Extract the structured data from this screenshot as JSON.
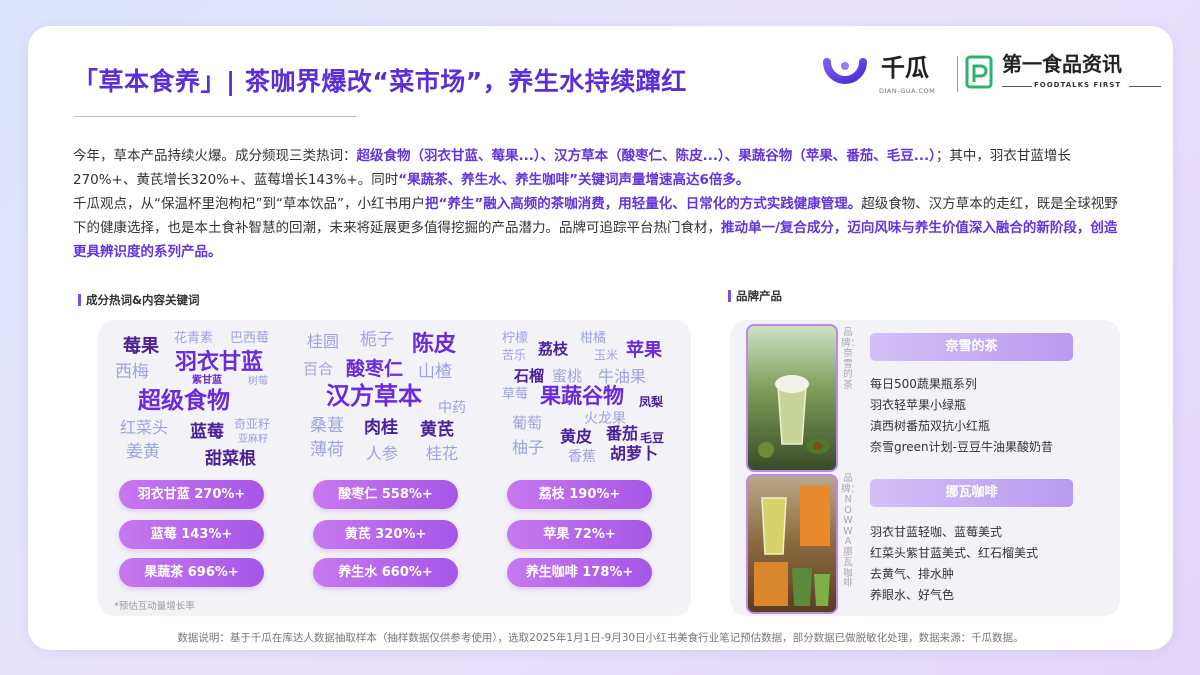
{
  "header": {
    "title": "「草本食养」| 茶咖界爆改“菜市场”，养生水持续蹿红",
    "logo1_name": "千瓜",
    "logo1_sub": "DIAN-GUA.COM",
    "logo2_name": "第一食品资讯",
    "logo2_sub": "FOODTALKS FIRST"
  },
  "intro": {
    "p1": [
      {
        "t": "今年，草本产品持续火爆。成分频现三类热词：",
        "hl": false
      },
      {
        "t": "超级食物（羽衣甘蓝、莓果...）、汉方草本（酸枣仁、陈皮...）、果蔬谷物（苹果、番茄、毛豆...）",
        "hl": true
      },
      {
        "t": "；其中，羽衣甘蓝增长270%+、黄芪增长320%+、蓝莓增长143%+。同时",
        "hl": false
      },
      {
        "t": "“果蔬茶、养生水、养生咖啡”关键词声量增速高达6倍多。",
        "hl": true
      }
    ],
    "p2": [
      {
        "t": "千瓜观点，从“保温杯里泡枸杞”到“草本饮品”，小红书用户",
        "hl": false
      },
      {
        "t": "把“养生”融入高频的茶咖消费，用轻量化、日常化的方式实践健康管理。",
        "hl": true
      },
      {
        "t": "超级食物、汉方草本的走红，既是全球视野下的健康选择，也是本土食补智慧的回潮，未来将延展更多值得挖掘的产品潜力。品牌可追踪平台热门食材，",
        "hl": false
      },
      {
        "t": "推动单一/复合成分，迈向风味与养生价值深入融合的新阶段，创造更具辨识度的系列产品。",
        "hl": true
      }
    ]
  },
  "sections": {
    "keywords_label": "成分热词&内容关键词",
    "brands_label": "品牌产品"
  },
  "wordclouds": [
    {
      "words": [
        {
          "t": "莓果",
          "s": 18,
          "c": "c3"
        },
        {
          "t": "花青素",
          "s": 13,
          "c": "c2"
        },
        {
          "t": "巴西莓",
          "s": 13,
          "c": "c2"
        },
        {
          "t": "西梅",
          "s": 17,
          "c": "c2"
        },
        {
          "t": "羽衣甘蓝",
          "s": 22,
          "c": "c1"
        },
        {
          "t": "紫甘蓝",
          "s": 10,
          "c": "c1"
        },
        {
          "t": "树莓",
          "s": 10,
          "c": "c2"
        },
        {
          "t": "超级食物",
          "s": 23,
          "c": "c1"
        },
        {
          "t": "红菜头",
          "s": 16,
          "c": "c2"
        },
        {
          "t": "蓝莓",
          "s": 17,
          "c": "c3"
        },
        {
          "t": "奇亚籽",
          "s": 12,
          "c": "c2"
        },
        {
          "t": "亚麻籽",
          "s": 10,
          "c": "c2"
        },
        {
          "t": "姜黄",
          "s": 17,
          "c": "c2"
        },
        {
          "t": "甜菜根",
          "s": 17,
          "c": "c3"
        }
      ]
    },
    {
      "words": [
        {
          "t": "桂圆",
          "s": 16,
          "c": "c2"
        },
        {
          "t": "栀子",
          "s": 17,
          "c": "c2"
        },
        {
          "t": "陈皮",
          "s": 22,
          "c": "c1"
        },
        {
          "t": "百合",
          "s": 15,
          "c": "c2"
        },
        {
          "t": "酸枣仁",
          "s": 19,
          "c": "c1"
        },
        {
          "t": "山楂",
          "s": 17,
          "c": "c2"
        },
        {
          "t": "汉方草本",
          "s": 24,
          "c": "c1"
        },
        {
          "t": "中药",
          "s": 14,
          "c": "c2"
        },
        {
          "t": "桑葚",
          "s": 17,
          "c": "c2"
        },
        {
          "t": "肉桂",
          "s": 17,
          "c": "c3"
        },
        {
          "t": "黄芪",
          "s": 17,
          "c": "c3"
        },
        {
          "t": "薄荷",
          "s": 17,
          "c": "c2"
        },
        {
          "t": "人参",
          "s": 16,
          "c": "c2"
        },
        {
          "t": "桂花",
          "s": 16,
          "c": "c2"
        }
      ]
    },
    {
      "words": [
        {
          "t": "柠檬",
          "s": 13,
          "c": "c2"
        },
        {
          "t": "柑橘",
          "s": 13,
          "c": "c2"
        },
        {
          "t": "苦乐",
          "s": 12,
          "c": "c2"
        },
        {
          "t": "荔枝",
          "s": 15,
          "c": "c3"
        },
        {
          "t": "玉米",
          "s": 12,
          "c": "c2"
        },
        {
          "t": "苹果",
          "s": 18,
          "c": "c1"
        },
        {
          "t": "石榴",
          "s": 15,
          "c": "c3"
        },
        {
          "t": "蜜桃",
          "s": 15,
          "c": "c2"
        },
        {
          "t": "牛油果",
          "s": 16,
          "c": "c2"
        },
        {
          "t": "草莓",
          "s": 13,
          "c": "c2"
        },
        {
          "t": "果蔬谷物",
          "s": 21,
          "c": "c1"
        },
        {
          "t": "凤梨",
          "s": 12,
          "c": "c3"
        },
        {
          "t": "葡萄",
          "s": 15,
          "c": "c2"
        },
        {
          "t": "火龙果",
          "s": 14,
          "c": "c2"
        },
        {
          "t": "黄皮",
          "s": 16,
          "c": "c3"
        },
        {
          "t": "番茄",
          "s": 16,
          "c": "c3"
        },
        {
          "t": "毛豆",
          "s": 12,
          "c": "c3"
        },
        {
          "t": "柚子",
          "s": 16,
          "c": "c2"
        },
        {
          "t": "香蕉",
          "s": 14,
          "c": "c2"
        },
        {
          "t": "胡萝卜",
          "s": 16,
          "c": "c3"
        }
      ]
    }
  ],
  "growth_pills": [
    [
      "羽衣甘蓝 270%+",
      "蓝莓 143%+",
      "果蔬茶 696%+"
    ],
    [
      "酸枣仁 558%+",
      "黄芪 320%+",
      "养生水 660%+"
    ],
    [
      "荔枝 190%+",
      "苹果 72%+",
      "养生咖啡 178%+"
    ]
  ],
  "footnote": "*预估互动量增长率",
  "brands": [
    {
      "photo_label": "品牌：奈雪的茶",
      "name": "奈雪的茶",
      "items": [
        "每日500蔬果瓶系列",
        "羽衣轻苹果小绿瓶",
        "滇西树番茄双抗小红瓶",
        "奈雪green计划-豆豆牛油果酸奶昔"
      ]
    },
    {
      "photo_label": "品牌：NOWWA挪瓦咖啡",
      "name": "挪瓦咖啡",
      "items": [
        "羽衣甘蓝轻咖、蓝莓美式",
        "红菜头紫甘蓝美式、红石榴美式",
        "去黄气、排水肿",
        "养眼水、好气色"
      ]
    }
  ],
  "source_note": "数据说明：基于千瓜在库达人数据抽取样本（抽样数据仅供参考使用），选取2025年1月1日-9月30日小红书美食行业笔记预估数据，部分数据已做脱敏化处理，数据来源：千瓜数据。",
  "colors": {
    "accent": "#5b2ed6",
    "highlight": "#6436d8",
    "pill": "#b063ea"
  }
}
